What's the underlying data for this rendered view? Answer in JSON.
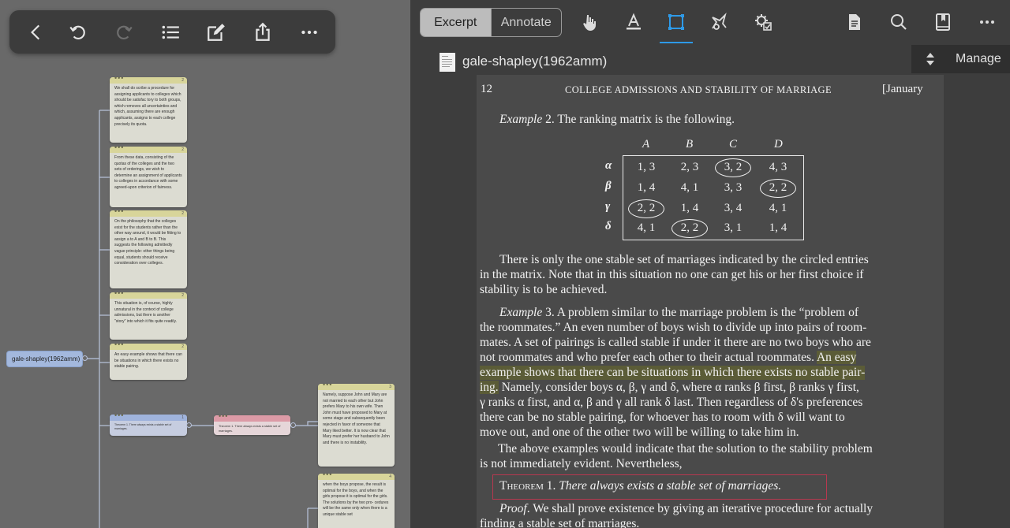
{
  "left_pane": {
    "root_label": "gale-shapley(1962amm)",
    "cards": [
      {
        "num": "2",
        "text": "We shall do scribe a procedure for assigning applicants to colleges which should be satisfac tory to both groups, which removes all uncertainties and which, assuming there are enough applicants, assigns to each college precisely its quota."
      },
      {
        "num": "2",
        "text": "From these data, consisting of the quotas of the colleges and the two sets of orderings, we wish to determine an assignment of applicants to colleges in accordance with some agreed-upon criterion of fairness."
      },
      {
        "num": "2",
        "text": "On the philosophy that the colleges exist for the students rather than the other way around, it would be fitting to assign a to A and B to B. This suggests the following admittedly vague principle: other things being equal, students should receive consideration over colleges."
      },
      {
        "num": "2",
        "text": "This situation is, of course, highly unnatural in the context of college admissions, but there is another \"story\" into which it fits quite readily."
      },
      {
        "num": "2",
        "text": "An easy example shows that there can be situations in which there exists no stable pairing."
      },
      {
        "num": "1",
        "text": "Theorem 1. There always exists a stable set of marriages."
      },
      {
        "num": "",
        "text": "Theorem 1. There always exists a stable set of marriages."
      },
      {
        "num": "3",
        "text": "Namely, suppose John and Mary are not married to each other but John prefers Mary to his own wife. Then John must have proposed to Mary at some stage and subsequently been rejected in favor of someone that Mary liked better. It is now clear that Mary must prefer her husband to John and there is no instability."
      },
      {
        "num": "4",
        "text": "when the boys propose, the result is optimal for the boys, and when the girls propose it is optimal for the girls. The solutions by the two pro- cedures will be the same only when there is a unique stable set"
      }
    ]
  },
  "right_pane": {
    "tabs": [
      "Excerpt",
      "Annotate"
    ],
    "active_tab": "Excerpt",
    "doc_title": "gale-shapley(1962amm)",
    "manage_label": "Manage",
    "accent_color": "#2e9ae8",
    "highlight_color": "#5b5c37",
    "theorem_box_color": "#b8384f"
  },
  "page": {
    "page_number": "12",
    "running_head": "COLLEGE ADMISSIONS AND STABILITY OF MARRIAGE",
    "date_head": "[January",
    "matrix": {
      "cols": [
        "A",
        "B",
        "C",
        "D"
      ],
      "rows": [
        "α",
        "β",
        "γ",
        "δ"
      ],
      "cells": [
        [
          "1, 3",
          "2, 3",
          "3, 2",
          "4, 3"
        ],
        [
          "1, 4",
          "4, 1",
          "3, 3",
          "2, 2"
        ],
        [
          "2, 2",
          "1, 4",
          "3, 4",
          "4, 1"
        ],
        [
          "4, 1",
          "2, 2",
          "3, 1",
          "1, 4"
        ]
      ],
      "circled": [
        "0-2",
        "1-3",
        "2-0",
        "3-1"
      ]
    },
    "lines": {
      "ex2": "Example 2. The ranking matrix is the following.",
      "p1a": "There is only the one stable set of marriages indicated by the circled entries",
      "p1b": "in the matrix. Note that in this situation no one can get his or her first choice if",
      "p1c": "stability is to be achieved.",
      "p2a": "Example 3. A problem similar to the marriage problem is the “problem of",
      "p2b": "the roommates.” An even number of boys wish to divide up into pairs of room-",
      "p2c": "mates. A set of pairings is called stable if under it there are no two boys who are",
      "p2d1": "not roommates and who prefer each other to their actual roommates. ",
      "p2d2": "An easy",
      "p2e": "example shows that there can be situations in which there exists no stable pair-",
      "p2f1": "ing.",
      "p2f2": " Namely, consider boys α, β, γ and δ, where α ranks β first, β ranks γ first,",
      "p2g": "γ ranks α first, and α, β and γ all rank δ last. Then regardless of δ's preferences",
      "p2h": "there can be no stable pairing, for whoever has to room with δ will want to",
      "p2i": "move out, and one of the other two will be willing to take him in.",
      "p3a": "The above examples would indicate that the solution to the stability problem",
      "p3b": "is not immediately evident. Nevertheless,",
      "thm": "Theorem 1. There always exists a stable set of marriages.",
      "proof1": "Proof. We shall prove existence by giving an iterative procedure for actually",
      "proof2": "finding a stable set of marriages."
    }
  }
}
